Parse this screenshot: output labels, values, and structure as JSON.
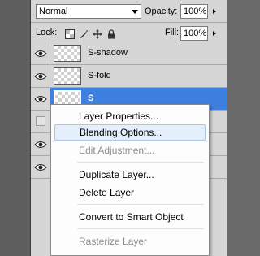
{
  "layers_panel": {
    "blend_mode": "Normal",
    "opacity_label": "Opacity:",
    "opacity_value": "100%",
    "lock_label": "Lock:",
    "lock_icons": [
      "lock-transparent-pixels-icon",
      "lock-image-pixels-icon",
      "lock-position-icon",
      "lock-all-icon"
    ],
    "fill_label": "Fill:",
    "fill_value": "100%",
    "layers": [
      {
        "name": "S-shadow",
        "visible": true,
        "selected": false
      },
      {
        "name": "S-fold",
        "visible": true,
        "selected": false
      },
      {
        "name": "S",
        "visible": true,
        "selected": true
      }
    ],
    "colors": {
      "selected_row": "#3d80df",
      "panel_bg": "#d6d6d6"
    }
  },
  "context_menu": {
    "items": [
      {
        "label": "Layer Properties...",
        "enabled": true
      },
      {
        "label": "Blending Options...",
        "enabled": true,
        "hovered": true
      },
      {
        "label": "Edit Adjustment...",
        "enabled": false
      },
      {
        "label": "Duplicate Layer...",
        "enabled": true
      },
      {
        "label": "Delete Layer",
        "enabled": true
      },
      {
        "label": "Convert to Smart Object",
        "enabled": true
      },
      {
        "label": "Rasterize Layer",
        "enabled": false
      }
    ]
  }
}
